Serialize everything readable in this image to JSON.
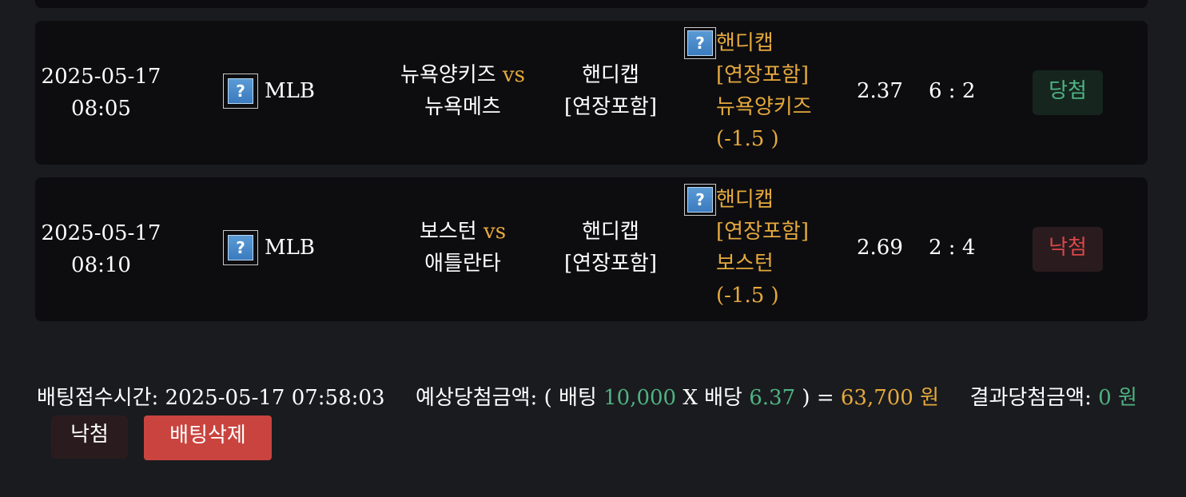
{
  "bets": [
    {
      "date": "2025-05-17",
      "time": "08:05",
      "league": "MLB",
      "home": "뉴욕양키즈",
      "vs": "vs",
      "away": "뉴욕메츠",
      "type_line1": "핸디캡",
      "type_line2": "[연장포함]",
      "pick_line1": "핸디캡",
      "pick_line2": "[연장포함]",
      "pick_line3": "뉴욕양키즈",
      "pick_line4": "(-1.5 )",
      "odds": "2.37",
      "score": "6 : 2",
      "result": "당첨"
    },
    {
      "date": "2025-05-17",
      "time": "08:10",
      "league": "MLB",
      "home": "보스턴",
      "vs": "vs",
      "away": "애틀란타",
      "type_line1": "핸디캡",
      "type_line2": "[연장포함]",
      "pick_line1": "핸디캡",
      "pick_line2": "[연장포함]",
      "pick_line3": "보스턴",
      "pick_line4": "(-1.5 )",
      "odds": "2.69",
      "score": "2 : 4",
      "result": "낙첨"
    }
  ],
  "summary": {
    "accept_label": "배팅접수시간:",
    "accept_time": "2025-05-17 07:58:03",
    "expected_label": "예상당첨금액: (",
    "bet_label": "배팅",
    "bet_amount": "10,000",
    "x": "X",
    "odds_label": "배당",
    "total_odds": "6.37",
    "equals": ") =",
    "expected_amount": "63,700",
    "won": "원",
    "result_label": "결과당첨금액:",
    "result_amount": "0",
    "result_won": "원"
  },
  "footer": {
    "status": "낙첨",
    "delete_label": "배팅삭제"
  },
  "colors": {
    "background": "#1a1b1f",
    "card": "#0d0d10",
    "gold": "#e5a93c",
    "green": "#4fb382",
    "red": "#d9474a",
    "delete_button": "#c9443f"
  },
  "icons": {
    "league_icon": "broken-image-icon",
    "pick_icon": "broken-image-icon"
  }
}
